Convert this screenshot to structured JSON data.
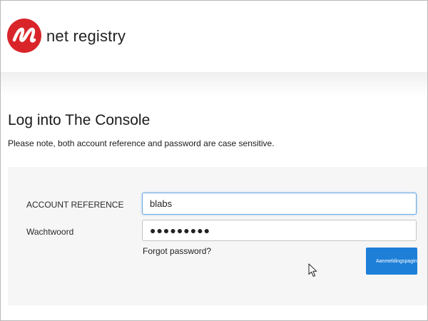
{
  "header": {
    "brand_name": "net registry",
    "logo_icon": "netregistry-logo-icon",
    "brand_color": "#d9252a"
  },
  "page": {
    "title": "Log into The Console",
    "note": "Please note, both account reference and password are case sensitive."
  },
  "form": {
    "account_label": "ACCOUNT REFERENCE",
    "account_value": "blabs",
    "password_label": "Wachtwoord",
    "password_value": "●●●●●●●●●",
    "forgot_label": "Forgot password?",
    "login_label": "Aanmeldingspagina",
    "accent_color": "#1e7fd8"
  },
  "cursor": {
    "icon": "mouse-pointer-icon"
  }
}
